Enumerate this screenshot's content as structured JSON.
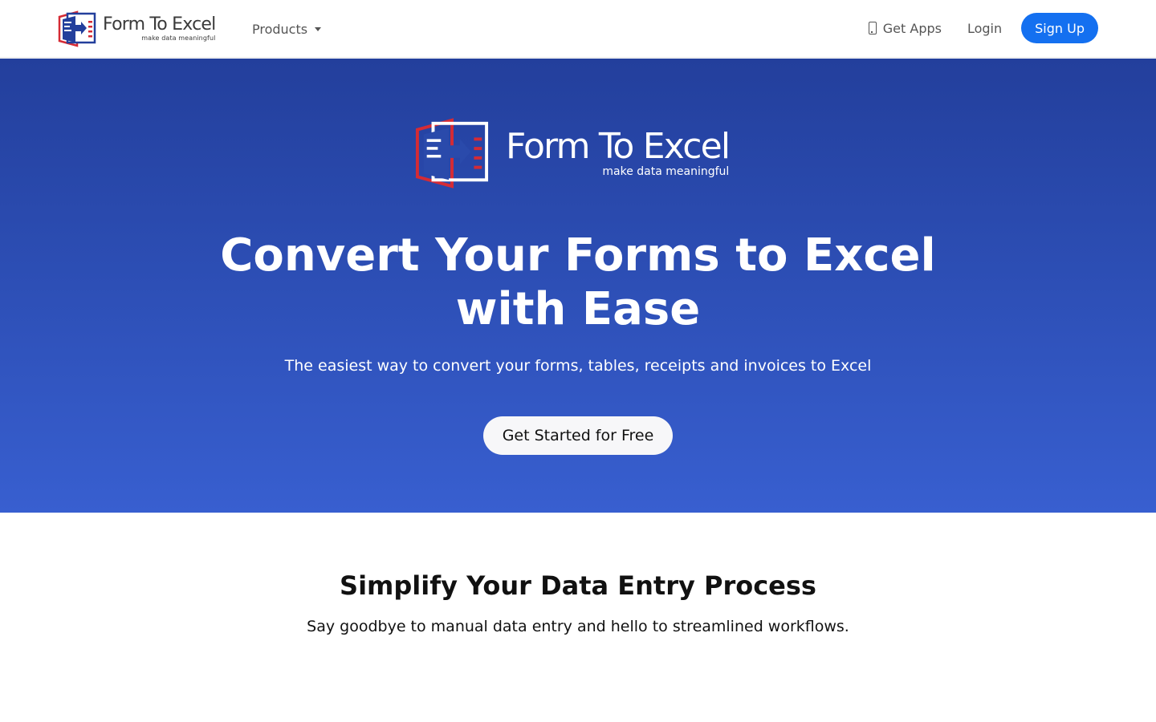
{
  "brand": {
    "name": "Form To Excel",
    "tagline": "make data meaningful",
    "colors": {
      "blue": "#233f9c",
      "red": "#d52b35"
    }
  },
  "nav": {
    "products_label": "Products",
    "get_apps_label": "Get Apps",
    "login_label": "Login",
    "signup_label": "Sign Up"
  },
  "hero": {
    "title_line1": "Convert Your Forms to Excel",
    "title_line2": "with Ease",
    "subtitle": "The easiest way to convert your forms, tables, receipts and invoices to Excel",
    "cta_label": "Get Started for Free"
  },
  "section": {
    "title": "Simplify Your Data Entry Process",
    "subtitle": "Say goodbye to manual data entry and hello to streamlined workflows."
  },
  "colors": {
    "hero_top": "#233f9c",
    "hero_bottom": "#385fd0",
    "primary_button": "#1470f0"
  },
  "icons": [
    "logo-icon",
    "phone-icon",
    "chevron-down-icon"
  ]
}
